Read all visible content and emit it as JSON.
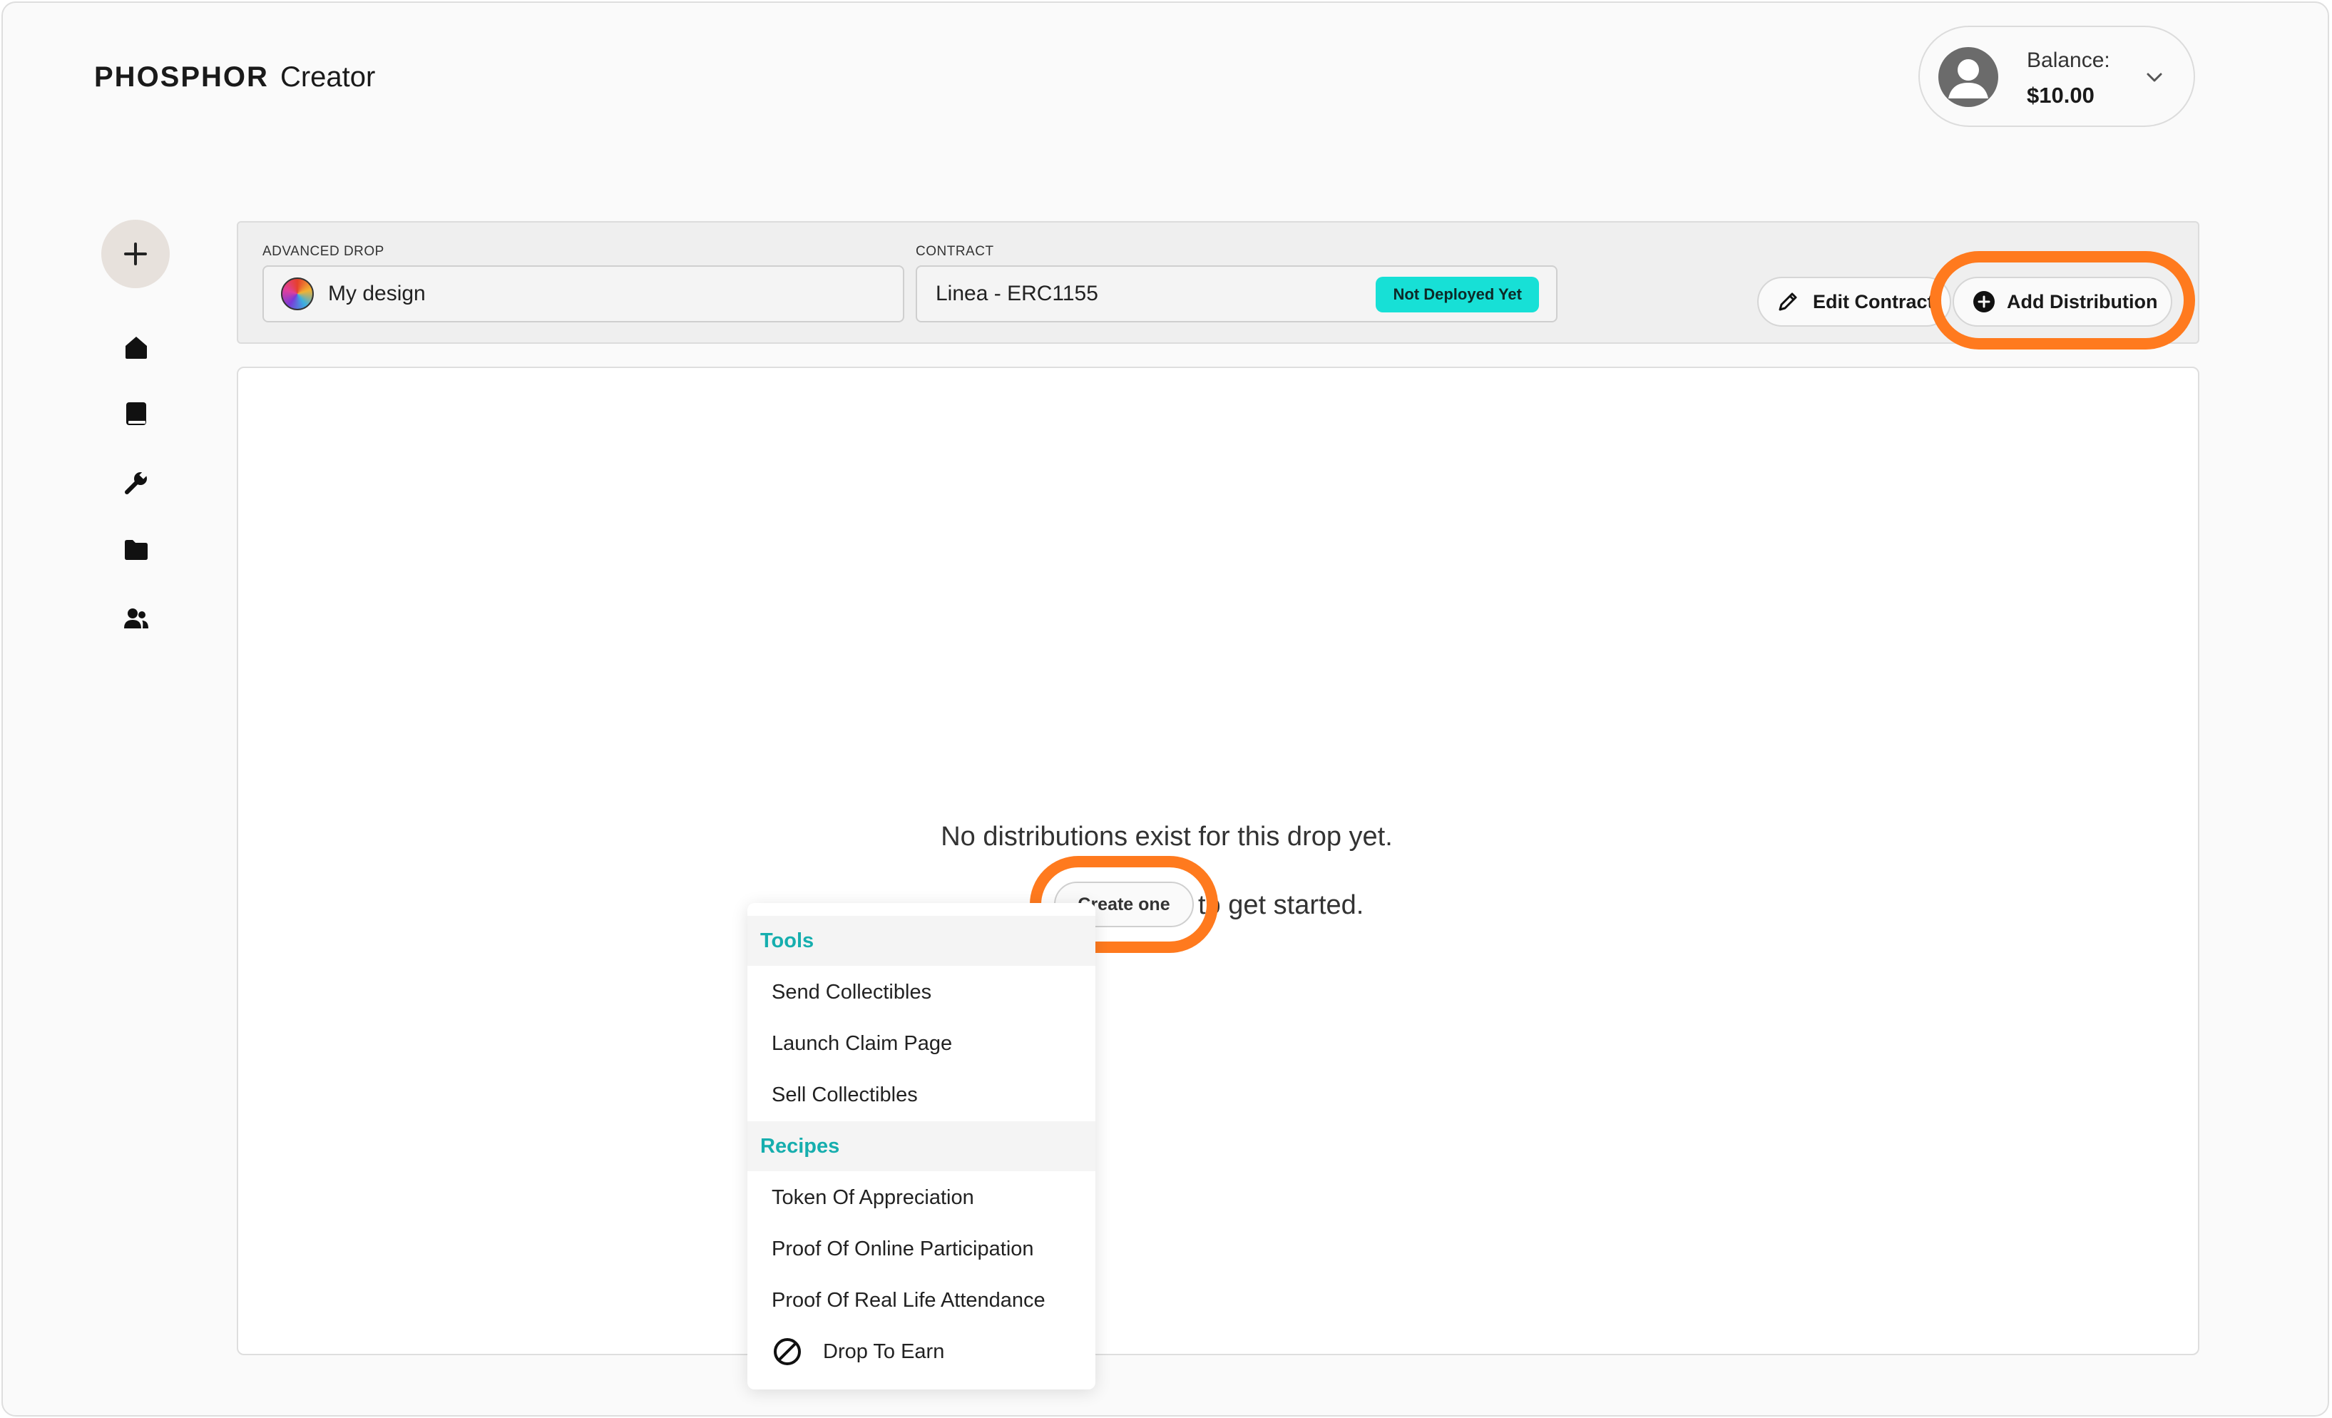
{
  "header": {
    "brand": "PHOSPHOR",
    "product": "Creator",
    "balance_label": "Balance:",
    "balance_amount": "$10.00"
  },
  "sidebar": {
    "icons": [
      "plus-icon",
      "home-icon",
      "book-icon",
      "wrench-icon",
      "folder-icon",
      "users-icon"
    ]
  },
  "drop_bar": {
    "drop_label": "ADVANCED DROP",
    "drop_value": "My design",
    "contract_label": "CONTRACT",
    "contract_value": "Linea - ERC1155",
    "contract_status": "Not Deployed Yet",
    "edit_contract": "Edit Contract",
    "add_distribution": "Add Distribution"
  },
  "empty_state": {
    "message": "No distributions exist for this drop yet.",
    "create_button": "Create one",
    "suffix": "to get started."
  },
  "menu": {
    "tools_header": "Tools",
    "tools": [
      "Send Collectibles",
      "Launch Claim Page",
      "Sell Collectibles"
    ],
    "recipes_header": "Recipes",
    "recipes": [
      "Token Of Appreciation",
      "Proof Of Online Participation",
      "Proof Of Real Life Attendance",
      "Drop To Earn"
    ]
  },
  "colors": {
    "accent_teal": "#16aeae",
    "badge_cyan": "#17e0d6",
    "highlight_orange": "#ff7a1e"
  }
}
